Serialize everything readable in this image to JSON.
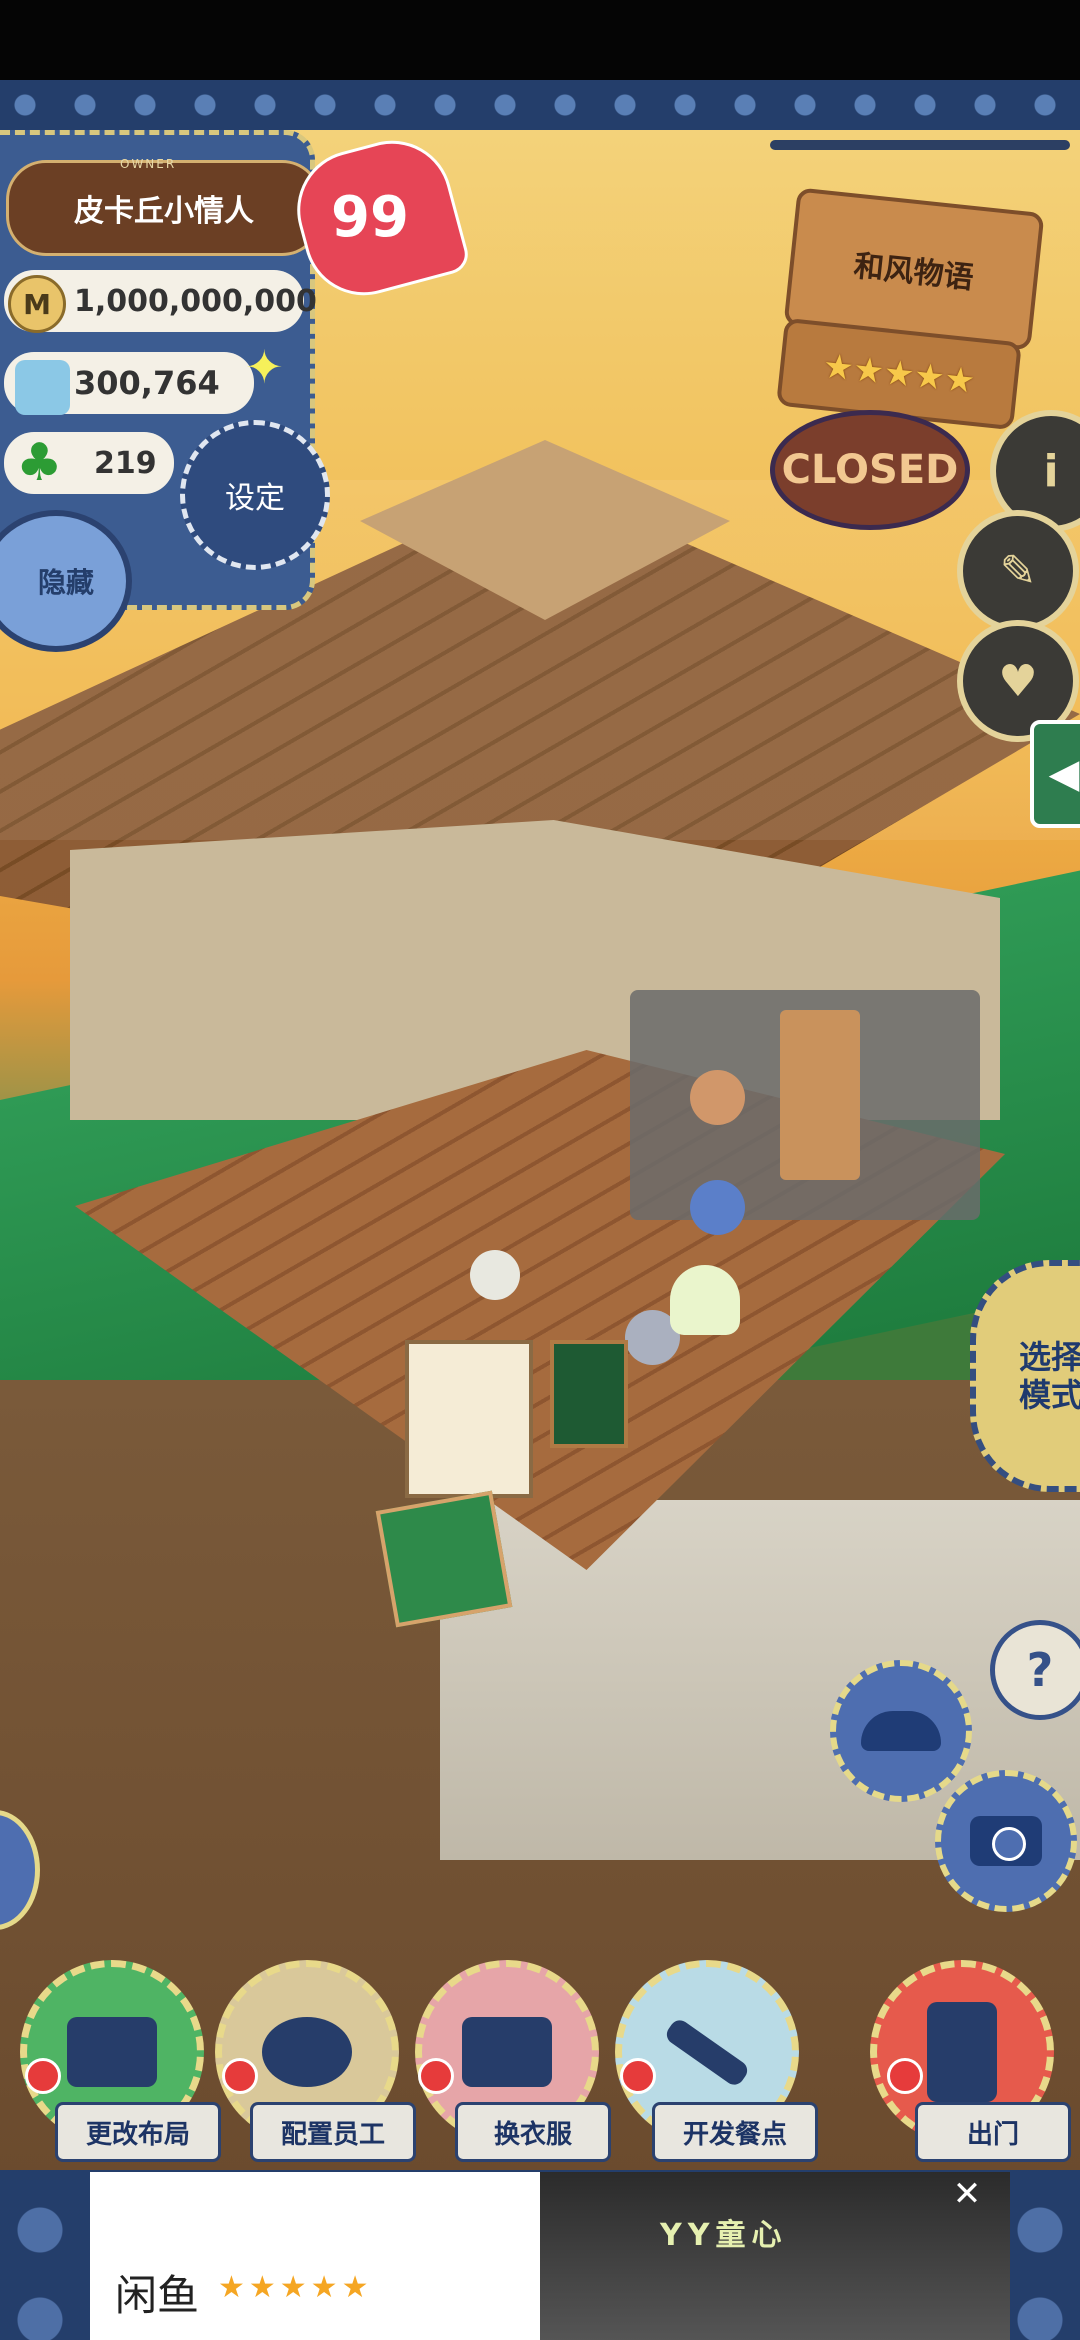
{
  "hud": {
    "owner_label": "OWNER",
    "owner_name": "皮卡丘小情人",
    "level": "99",
    "money": "1,000,000,000",
    "money_icon_letter": "M",
    "ice": "300,764",
    "clover": "219",
    "settings_label": "设定",
    "hide_label": "隐藏"
  },
  "shop": {
    "name": "和风物语",
    "rating_stars": "★★★★★",
    "status": "CLOSED"
  },
  "side_buttons": {
    "info": "i",
    "mode_line1": "选择",
    "mode_line2": "模式",
    "help": "?"
  },
  "actions": [
    {
      "label": "更改布局"
    },
    {
      "label": "配置员工"
    },
    {
      "label": "换衣服"
    },
    {
      "label": "开发餐点"
    },
    {
      "label": "出门"
    }
  ],
  "ad": {
    "title": "闲鱼",
    "stars": "★★★★★",
    "brand": "YY童心",
    "close": "✕"
  },
  "colors": {
    "accent_gold": "#e8d98a",
    "navy": "#243e6b",
    "heart_red": "#e64556"
  }
}
